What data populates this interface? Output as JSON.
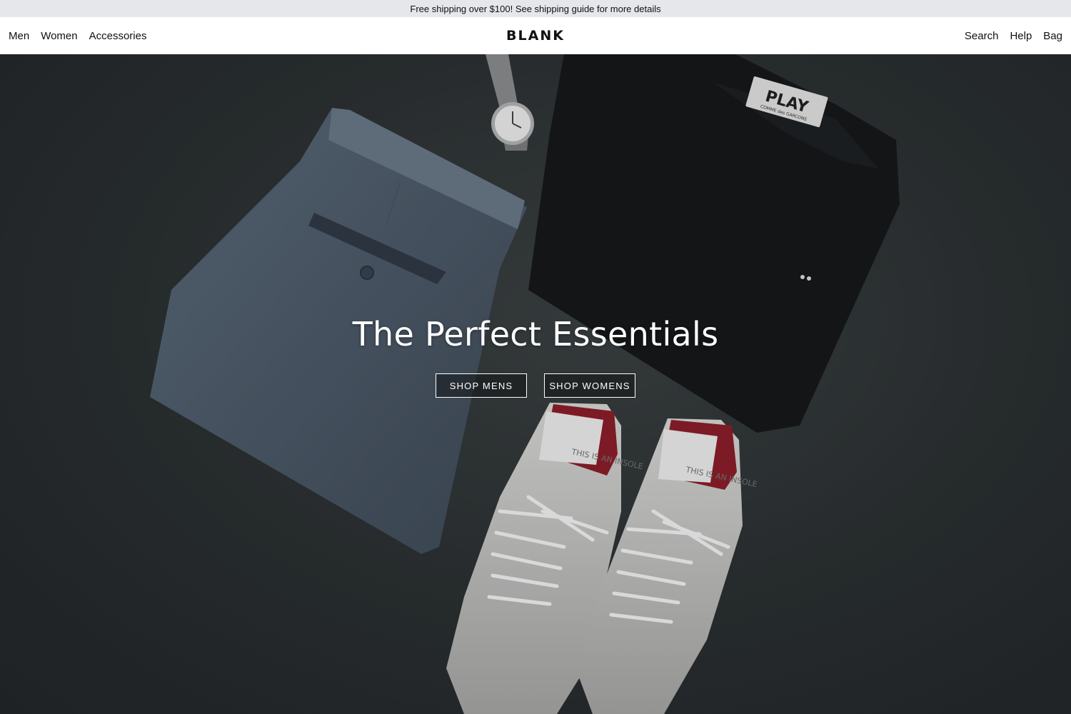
{
  "announcement": {
    "text": "Free shipping over $100! See shipping guide for more details"
  },
  "header": {
    "logo": "BLANK",
    "nav_left": [
      "Men",
      "Women",
      "Accessories"
    ],
    "nav_right": [
      "Search",
      "Help",
      "Bag"
    ]
  },
  "hero": {
    "title": "The Perfect Essentials",
    "buttons": [
      "SHOP MENS",
      "SHOP WOMENS"
    ],
    "image_label": {
      "brand": "PLAY",
      "sub": "COMME des GARCONS"
    },
    "insole_text": "THIS IS AN INSOLE"
  },
  "colors": {
    "announcement_bg": "#e5e7eb",
    "header_bg": "#ffffff",
    "hero_bg": "#2b3032",
    "text_light": "#ffffff"
  }
}
